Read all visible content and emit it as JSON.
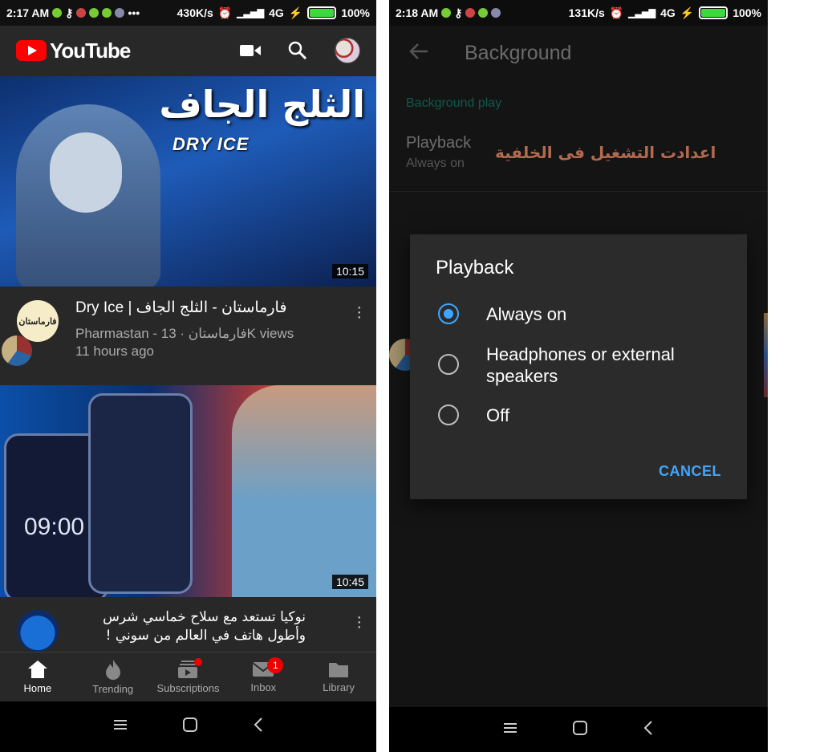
{
  "left": {
    "status": {
      "time": "2:17 AM",
      "speed": "430K/s",
      "network": "4G",
      "battery": "100%"
    },
    "app": {
      "brand": "YouTube"
    },
    "videos": [
      {
        "thumb_title_ar": "الثلج الجاف",
        "thumb_title_en": "DRY ICE",
        "duration": "10:15",
        "title": "Dry Ice | فارماستان - الثلج الجاف",
        "channel_line": "Pharmastan - فارماستان · 13K views",
        "age": "11 hours ago",
        "avatar_text": "فارماستان"
      },
      {
        "thumb_text": "09:00",
        "duration": "10:45",
        "title": "نوكيا تستعد مع سلاح خماسي شرس وأطول هاتف في العالم من سوني !"
      }
    ],
    "nav": [
      {
        "label": "Home",
        "icon": "home-icon"
      },
      {
        "label": "Trending",
        "icon": "fire-icon"
      },
      {
        "label": "Subscriptions",
        "icon": "subscriptions-icon"
      },
      {
        "label": "Inbox",
        "icon": "mail-icon",
        "badge": "1"
      },
      {
        "label": "Library",
        "icon": "folder-icon"
      }
    ]
  },
  "right": {
    "status": {
      "time": "2:18 AM",
      "speed": "131K/s",
      "network": "4G",
      "battery": "100%"
    },
    "page_title": "Background",
    "section": "Background play",
    "setting": {
      "label": "Playback",
      "value": "Always on"
    },
    "annotation": "اعدادت التشغيل فى الخلفية",
    "dialog": {
      "title": "Playback",
      "options": [
        "Always on",
        "Headphones or external speakers",
        "Off"
      ],
      "selected": "Always on",
      "cancel": "CANCEL"
    }
  },
  "colors": {
    "youtube_red": "#ff0000",
    "accent_blue": "#3ea6ff",
    "battery_green": "#3ed83e"
  }
}
